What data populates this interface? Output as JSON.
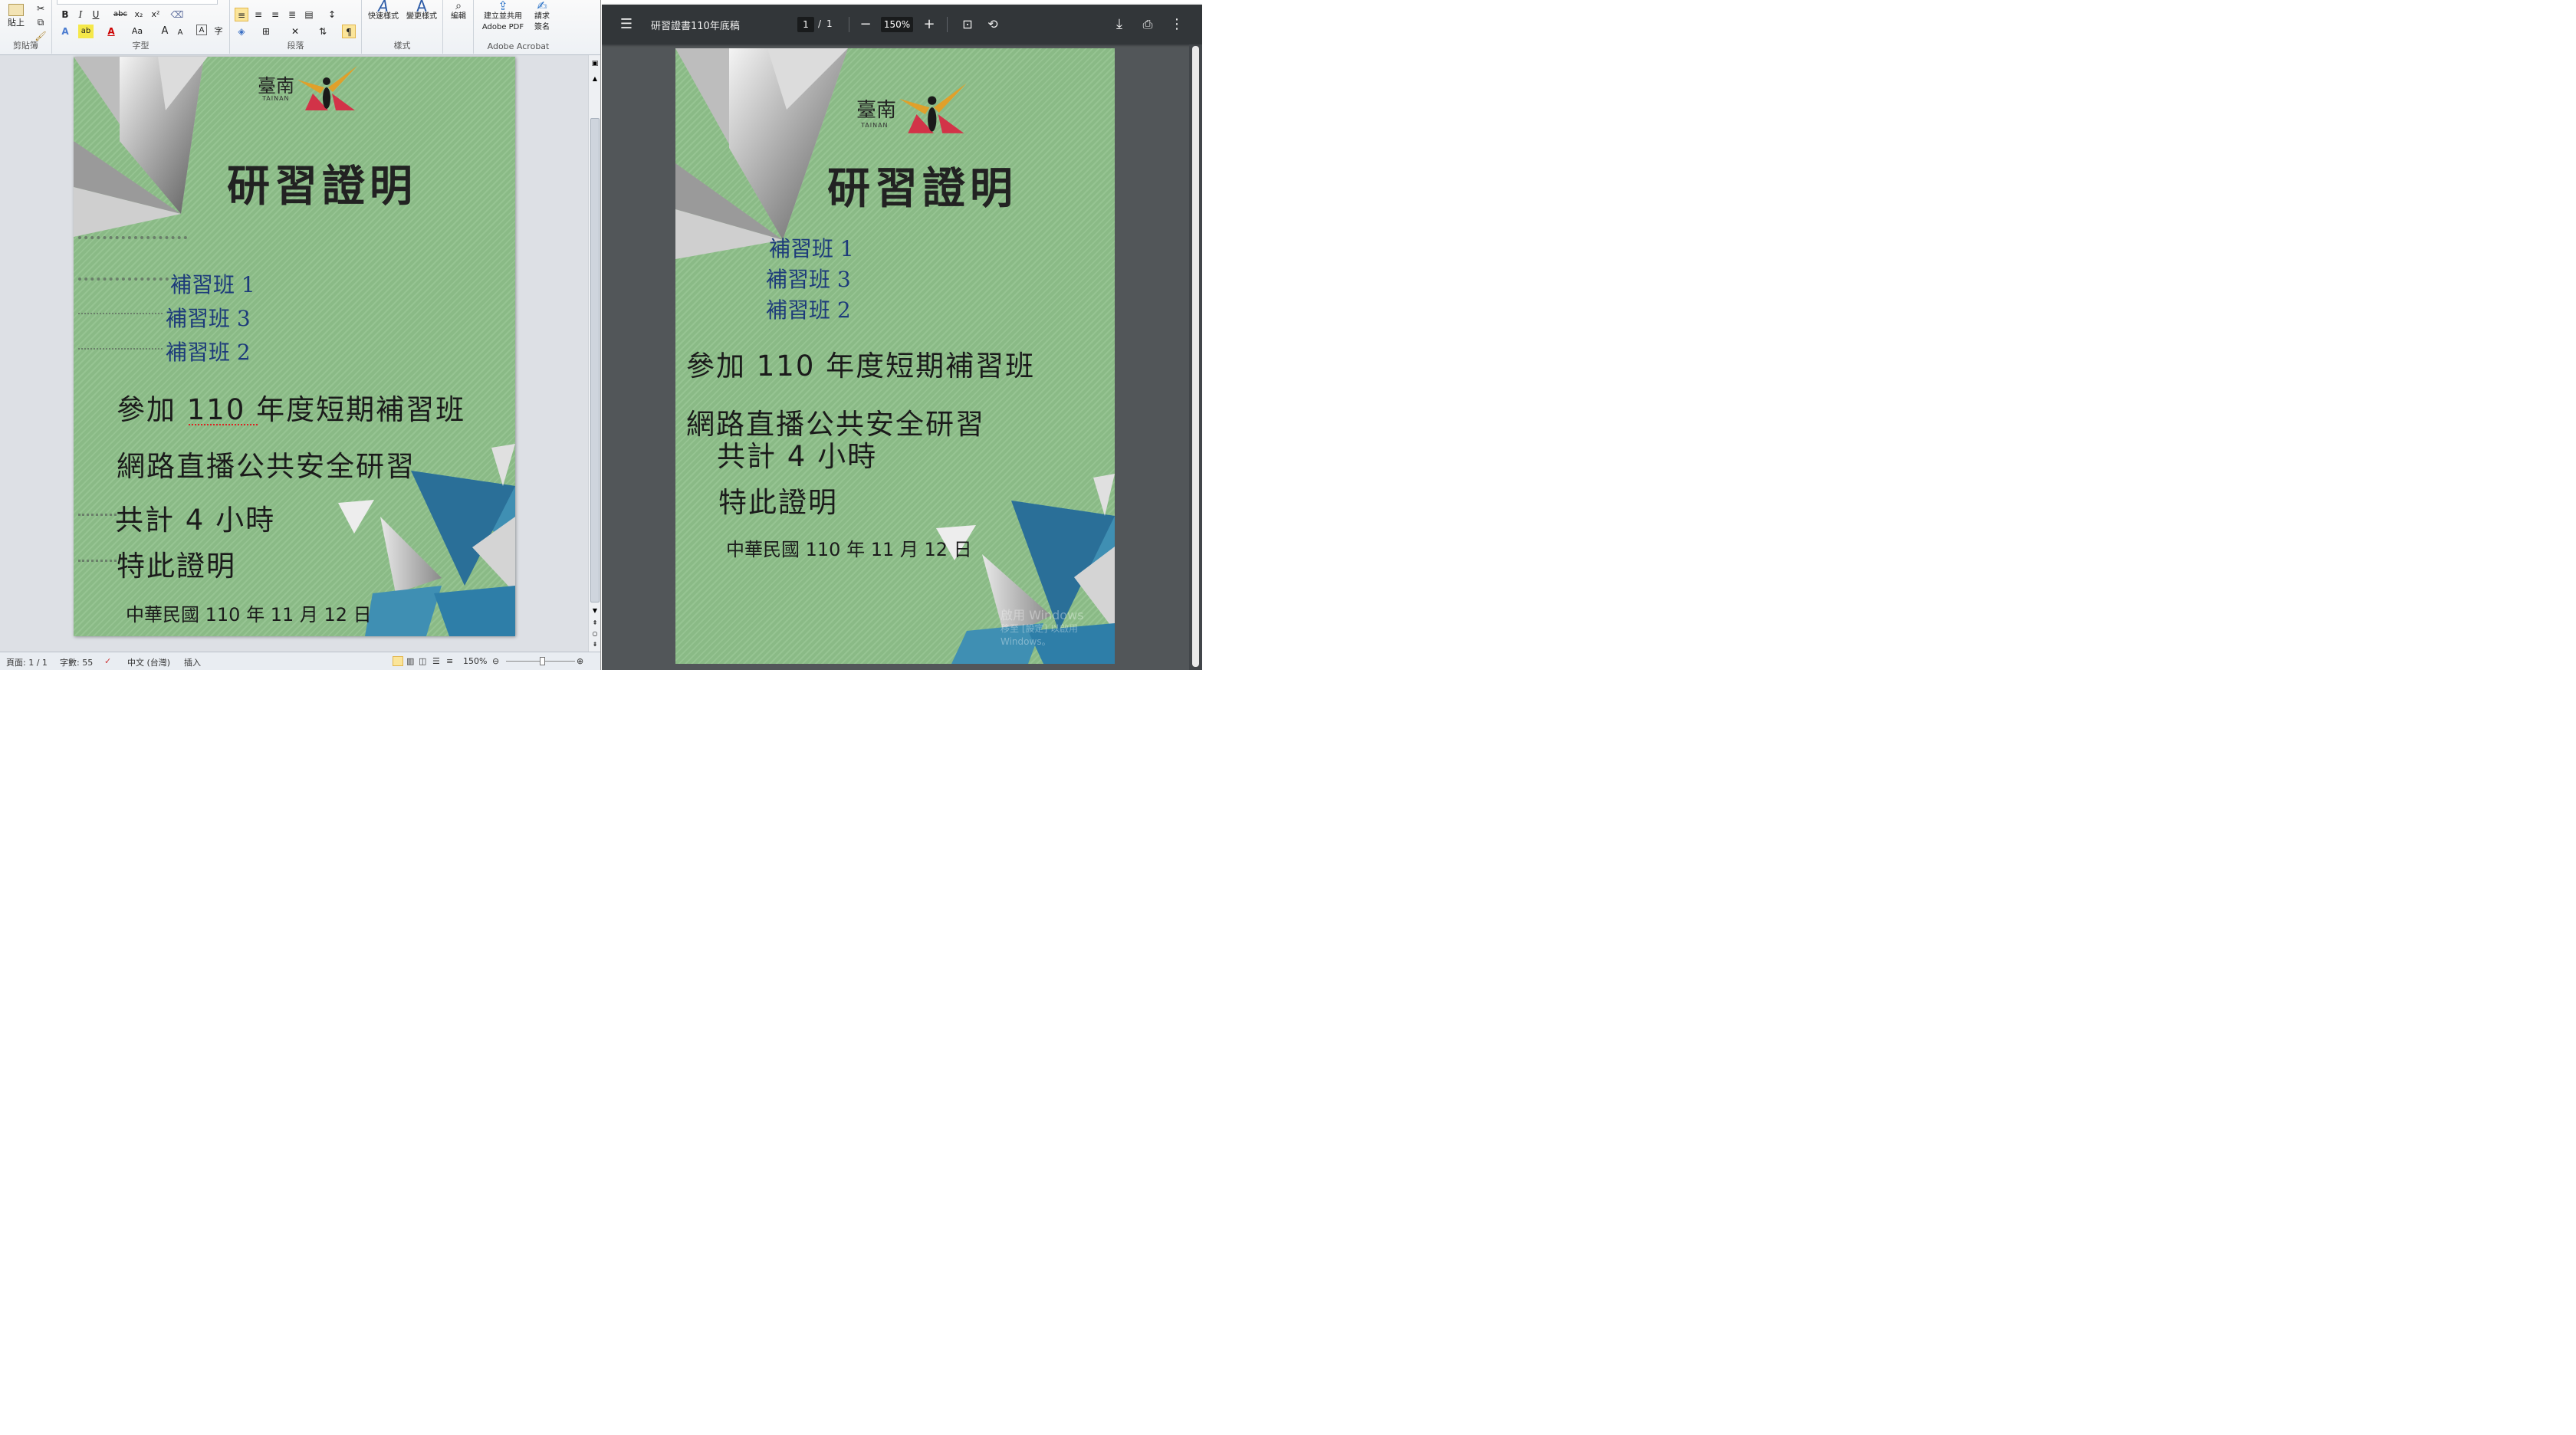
{
  "word": {
    "ribbon": {
      "clipboard": {
        "paste_label": "貼上",
        "group_label": "剪貼簿"
      },
      "font": {
        "group_label": "字型",
        "bold": "B",
        "italic": "I",
        "underline": "U",
        "strike": "abc",
        "subscript": "x₂",
        "superscript": "x²",
        "clear": "A",
        "grow": "A",
        "shrink": "A",
        "case": "Aa",
        "highlight": "ab",
        "font_color": "A",
        "char_border": "A",
        "phonetic": "字"
      },
      "paragraph": {
        "group_label": "段落"
      },
      "styles": {
        "quick_styles": "快速樣式",
        "change_styles": "變更樣式",
        "group_label": "樣式"
      },
      "editing": {
        "label": "編輯"
      },
      "acrobat": {
        "create_pdf_line1": "建立並共用",
        "create_pdf_line2": "Adobe PDF",
        "sign_line1": "請求",
        "sign_line2": "簽名",
        "group_label": "Adobe Acrobat"
      }
    },
    "document": {
      "logo_text": "臺南",
      "logo_sub": "TAINAN",
      "title": "研習證明",
      "classes": [
        "補習班 1",
        "補習班 3",
        "補習班 2"
      ],
      "line1": "參加 110 年度短期補習班",
      "line2": "網路直播公共安全研習",
      "line3": "共計 4 小時",
      "line4": "特此證明",
      "date": "中華民國 110 年 11 月 12 日"
    },
    "statusbar": {
      "page": "頁面: 1 / 1",
      "words": "字數: 55",
      "language": "中文 (台灣)",
      "mode": "插入",
      "zoom": "150%"
    }
  },
  "pdf": {
    "toolbar": {
      "title": "研習證書110年底稿",
      "page_current": "1",
      "page_sep": "/",
      "page_total": "1",
      "zoom": "150%"
    },
    "document": {
      "logo_text": "臺南",
      "logo_sub": "TAINAN",
      "title": "研習證明",
      "classes": [
        "補習班 1",
        "補習班 3",
        "補習班 2"
      ],
      "line1": "參加 110 年度短期補習班",
      "line2": "網路直播公共安全研習",
      "line3": "共計 4 小時",
      "line4": "特此證明",
      "date": "中華民國 110 年 11 月 12 日"
    },
    "watermark": {
      "line1": "啟用 Windows",
      "line2": "移至 [設定] 以啟用 Windows。"
    }
  },
  "colors": {
    "page_green": "#8ec08a",
    "class_blue": "#1d3b7a",
    "pdf_toolbar": "#323639",
    "pdf_bg": "#525659"
  }
}
